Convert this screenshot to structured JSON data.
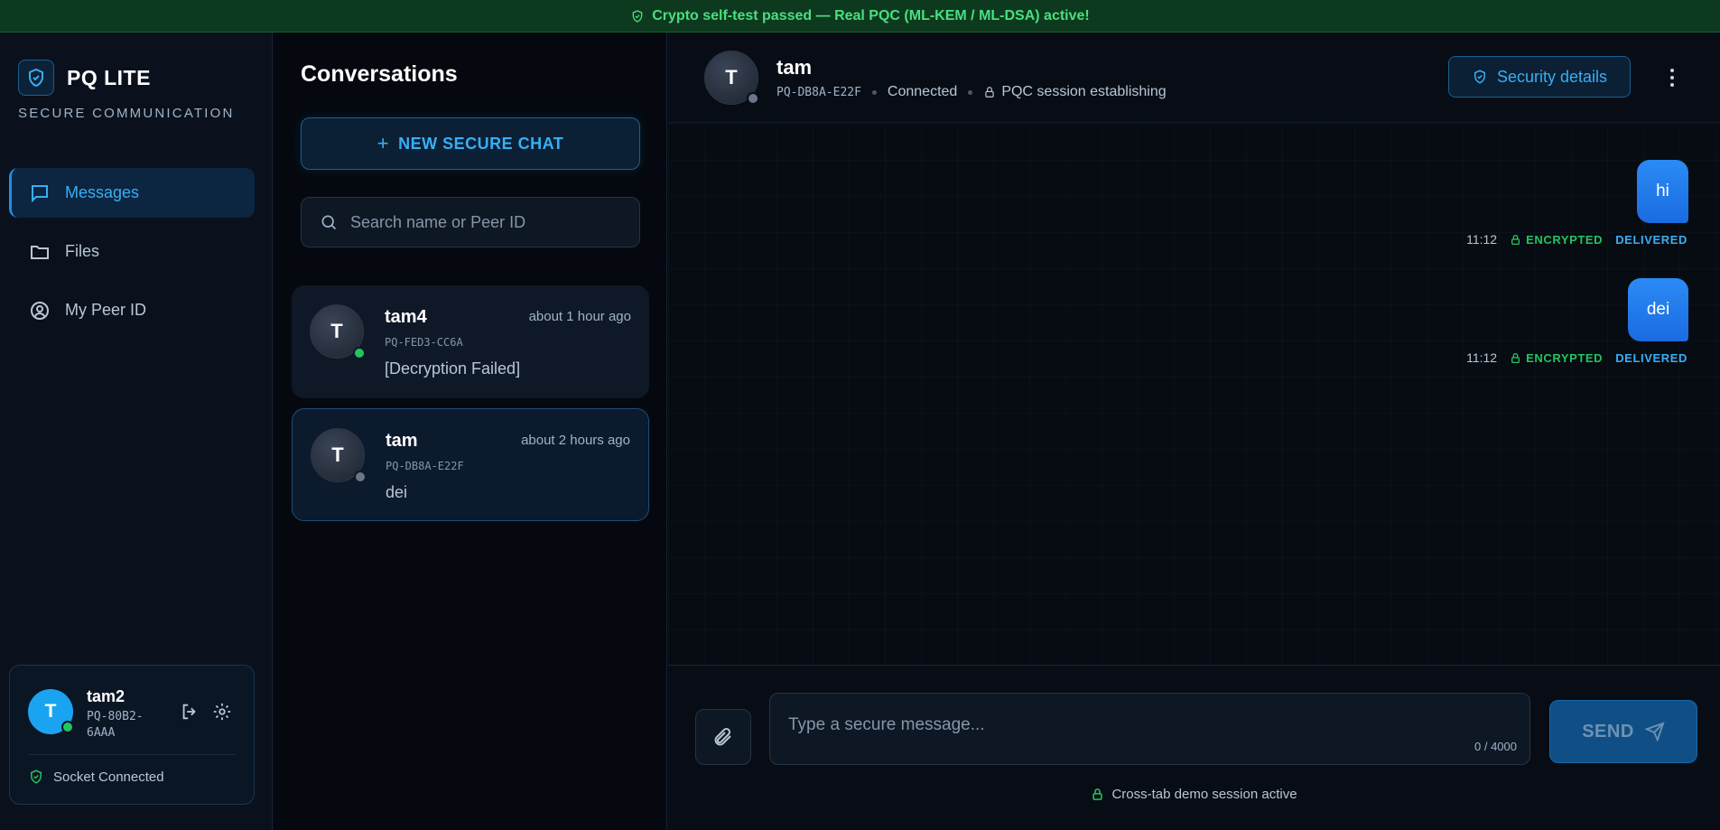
{
  "banner": {
    "text": "Crypto self-test passed — Real PQC (ML-KEM / ML-DSA) active!"
  },
  "brand": {
    "name": "PQ LITE",
    "subtitle": "SECURE COMMUNICATION"
  },
  "nav": [
    {
      "label": "Messages",
      "icon": "message-icon",
      "active": true
    },
    {
      "label": "Files",
      "icon": "folder-icon",
      "active": false
    },
    {
      "label": "My Peer ID",
      "icon": "user-circle-icon",
      "active": false
    }
  ],
  "user": {
    "avatar_letter": "T",
    "name": "tam2",
    "peer_id": "PQ-80B2-6AAA",
    "socket_status": "Socket Connected"
  },
  "conversations": {
    "title": "Conversations",
    "new_chat_label": "NEW SECURE CHAT",
    "search_placeholder": "Search name or Peer ID",
    "items": [
      {
        "avatar_letter": "T",
        "name": "tam4",
        "time": "about 1 hour ago",
        "peer_id": "PQ-FED3-CC6A",
        "preview": "[Decryption Failed]",
        "online": true
      },
      {
        "avatar_letter": "T",
        "name": "tam",
        "time": "about 2 hours ago",
        "peer_id": "PQ-DB8A-E22F",
        "preview": "dei",
        "online": false
      }
    ]
  },
  "chat": {
    "avatar_letter": "T",
    "name": "tam",
    "peer_id": "PQ-DB8A-E22F",
    "status": "Connected",
    "session": "PQC session establishing",
    "security_button": "Security details",
    "messages": [
      {
        "text": "hi",
        "time": "11:12",
        "encrypted": "ENCRYPTED",
        "delivery": "DELIVERED"
      },
      {
        "text": "dei",
        "time": "11:12",
        "encrypted": "ENCRYPTED",
        "delivery": "DELIVERED"
      }
    ],
    "composer": {
      "placeholder": "Type a secure message...",
      "counter": "0 / 4000",
      "send_label": "SEND",
      "note": "Cross-tab demo session active"
    }
  },
  "colors": {
    "accent": "#38aef5",
    "success": "#22c55e",
    "bubble": "#1a6be0"
  }
}
